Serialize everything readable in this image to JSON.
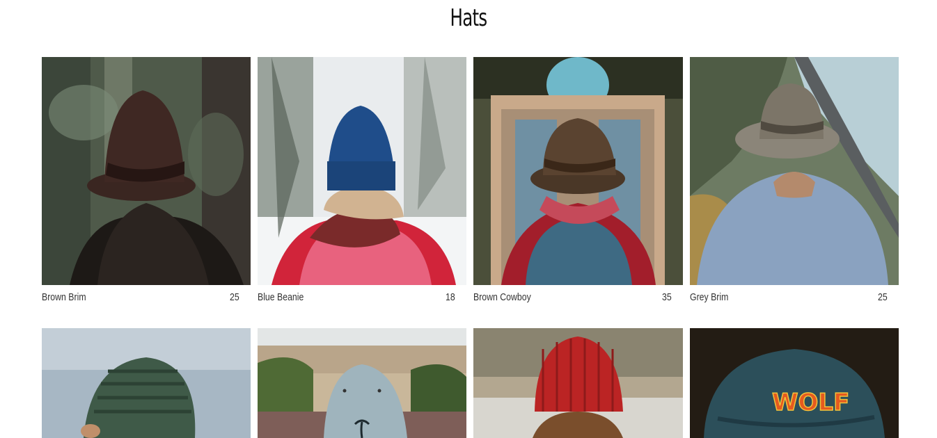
{
  "page": {
    "title": "Hats"
  },
  "products": [
    {
      "name": "Brown Brim",
      "price": "25",
      "image": "brown-brim-photo"
    },
    {
      "name": "Blue Beanie",
      "price": "18",
      "image": "blue-beanie-photo"
    },
    {
      "name": "Brown Cowboy",
      "price": "35",
      "image": "brown-cowboy-photo"
    },
    {
      "name": "Grey Brim",
      "price": "25",
      "image": "grey-brim-photo"
    },
    {
      "name": "",
      "price": "",
      "image": "green-beanie-photo"
    },
    {
      "name": "",
      "price": "",
      "image": "palm-tree-cap-photo"
    },
    {
      "name": "",
      "price": "",
      "image": "red-beanie-photo"
    },
    {
      "name": "",
      "price": "",
      "image": "wolf-cap-photo"
    }
  ],
  "wolf_cap_text": "WOLF",
  "colors": {
    "background": "#ffffff",
    "text": "#333333"
  }
}
